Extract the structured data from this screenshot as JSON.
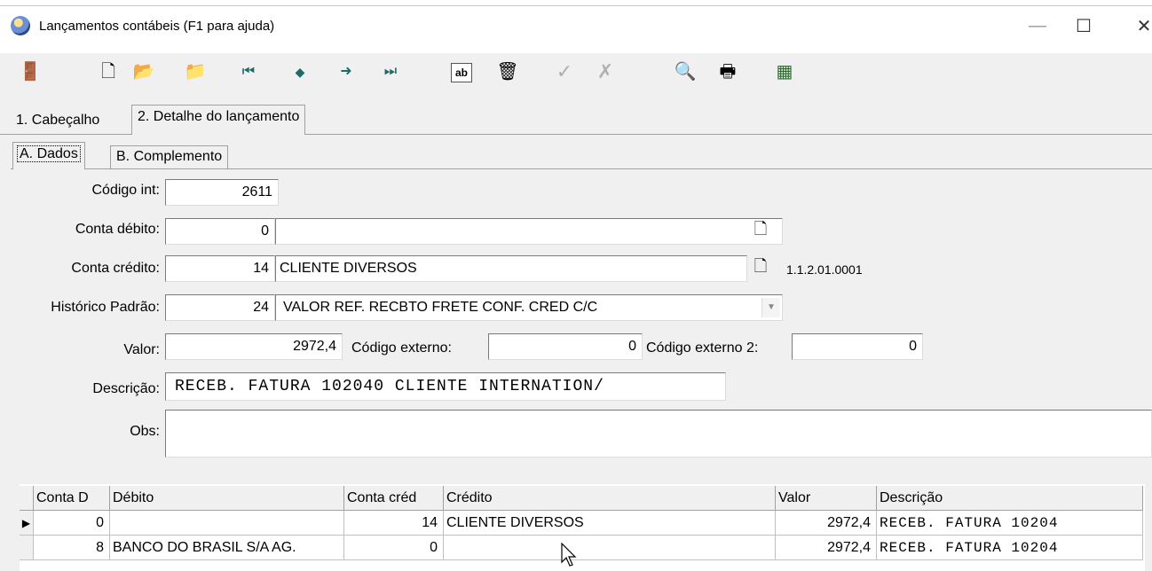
{
  "window": {
    "title": "Lançamentos contábeis (F1 para ajuda)",
    "minimize": "—",
    "maximize": "☐",
    "close": "✕"
  },
  "toolbar": [
    {
      "name": "exit-icon",
      "glyph": "🚪"
    },
    {
      "name": "new-doc-icon",
      "glyph": "🗋"
    },
    {
      "name": "open-folder-icon",
      "glyph": "📂"
    },
    {
      "name": "folder-up-icon",
      "glyph": "📁"
    },
    {
      "name": "first-record-icon",
      "glyph": "⏮"
    },
    {
      "name": "prev-record-icon",
      "glyph": "◆"
    },
    {
      "name": "next-record-icon",
      "glyph": "➜"
    },
    {
      "name": "last-record-icon",
      "glyph": "⏭"
    },
    {
      "name": "edit-ab-icon",
      "glyph": "ab"
    },
    {
      "name": "trash-icon",
      "glyph": "🗑"
    },
    {
      "name": "confirm-check-icon",
      "glyph": "✓"
    },
    {
      "name": "cancel-x-icon",
      "glyph": "✗"
    },
    {
      "name": "search-preview-icon",
      "glyph": "🔍"
    },
    {
      "name": "printer-icon",
      "glyph": "🖶"
    },
    {
      "name": "calculator-icon",
      "glyph": "▦"
    }
  ],
  "tabs": {
    "main": [
      "1. Cabeçalho",
      "2. Detalhe do lançamento"
    ],
    "sub": [
      "A. Dados",
      "B. Complemento"
    ]
  },
  "form": {
    "codigo_int_label": "Código int:",
    "codigo_int": "2611",
    "conta_debito_label": "Conta débito:",
    "conta_debito_num": "0",
    "conta_debito_desc": "",
    "conta_credito_label": "Conta crédito:",
    "conta_credito_num": "14",
    "conta_credito_desc": "CLIENTE DIVERSOS",
    "conta_credito_code": "1.1.2.01.0001",
    "historico_label": "Histórico Padrão:",
    "historico_num": "24",
    "historico_desc": "VALOR REF. RECBTO FRETE CONF. CRED C/C",
    "valor_label": "Valor:",
    "valor": "2972,4",
    "cod_externo_label": "Código externo:",
    "cod_externo": "0",
    "cod_externo2_label": "Código externo 2:",
    "cod_externo2": "0",
    "descricao_label": "Descrição:",
    "descricao": "RECEB. FATURA 102040 CLIENTE INTERNATION/",
    "obs_label": "Obs:",
    "obs": ""
  },
  "grid": {
    "columns": [
      "Conta D",
      "Débito",
      "Conta créd",
      "Crédito",
      "Valor",
      "Descrição"
    ],
    "rows": [
      {
        "conta_d": "0",
        "debito": "",
        "conta_cred": "14",
        "credito": "CLIENTE DIVERSOS",
        "valor": "2972,4",
        "descricao": "RECEB. FATURA 10204"
      },
      {
        "conta_d": "8",
        "debito": "BANCO DO BRASIL S/A AG.",
        "conta_cred": "0",
        "credito": "",
        "valor": "2972,4",
        "descricao": "RECEB. FATURA 10204"
      }
    ]
  }
}
